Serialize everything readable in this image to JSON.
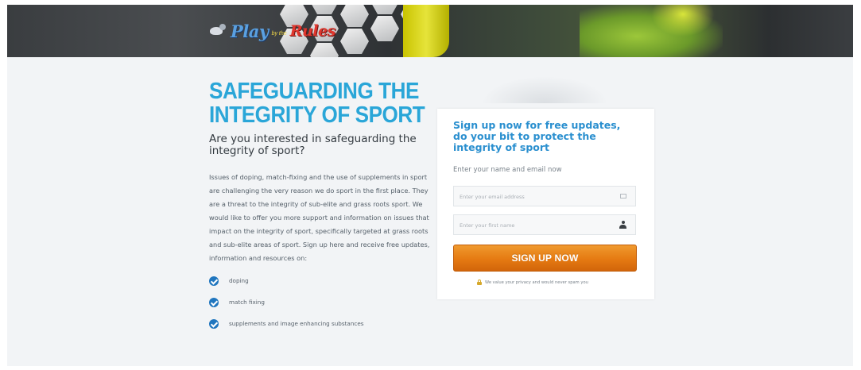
{
  "header": {
    "logo": {
      "play": "Play",
      "by": "by the",
      "rules": "Rules"
    }
  },
  "intro": {
    "headline_line1": "SAFEGUARDING THE",
    "headline_line2": "INTEGRITY OF SPORT",
    "subhead": "Are you interested in safeguarding the integrity of sport?",
    "body": "Issues of doping, match-fixing and the use of supplements in sport are challenging the very reason we do sport in the first place. They are a threat to the integrity of sub-elite and grass roots sport. We would like to offer you more support and information on issues that impact on the integrity of sport, specifically targeted at grass roots and sub-elite areas of sport. Sign up here and receive free updates, information and resources on:",
    "list": [
      "doping",
      "match fixing",
      "supplements and image enhancing substances"
    ]
  },
  "form": {
    "title": "Sign up now for free updates, do your bit to protect the integrity of sport",
    "subtitle": "Enter your name and email now",
    "email_placeholder": "Enter your email address",
    "name_placeholder": "Enter your first name",
    "button_label": "SIGN UP NOW",
    "privacy_note": "We value your privacy and would never spam you",
    "button_color": "#e57a12",
    "accent_color": "#2aa6d8"
  }
}
